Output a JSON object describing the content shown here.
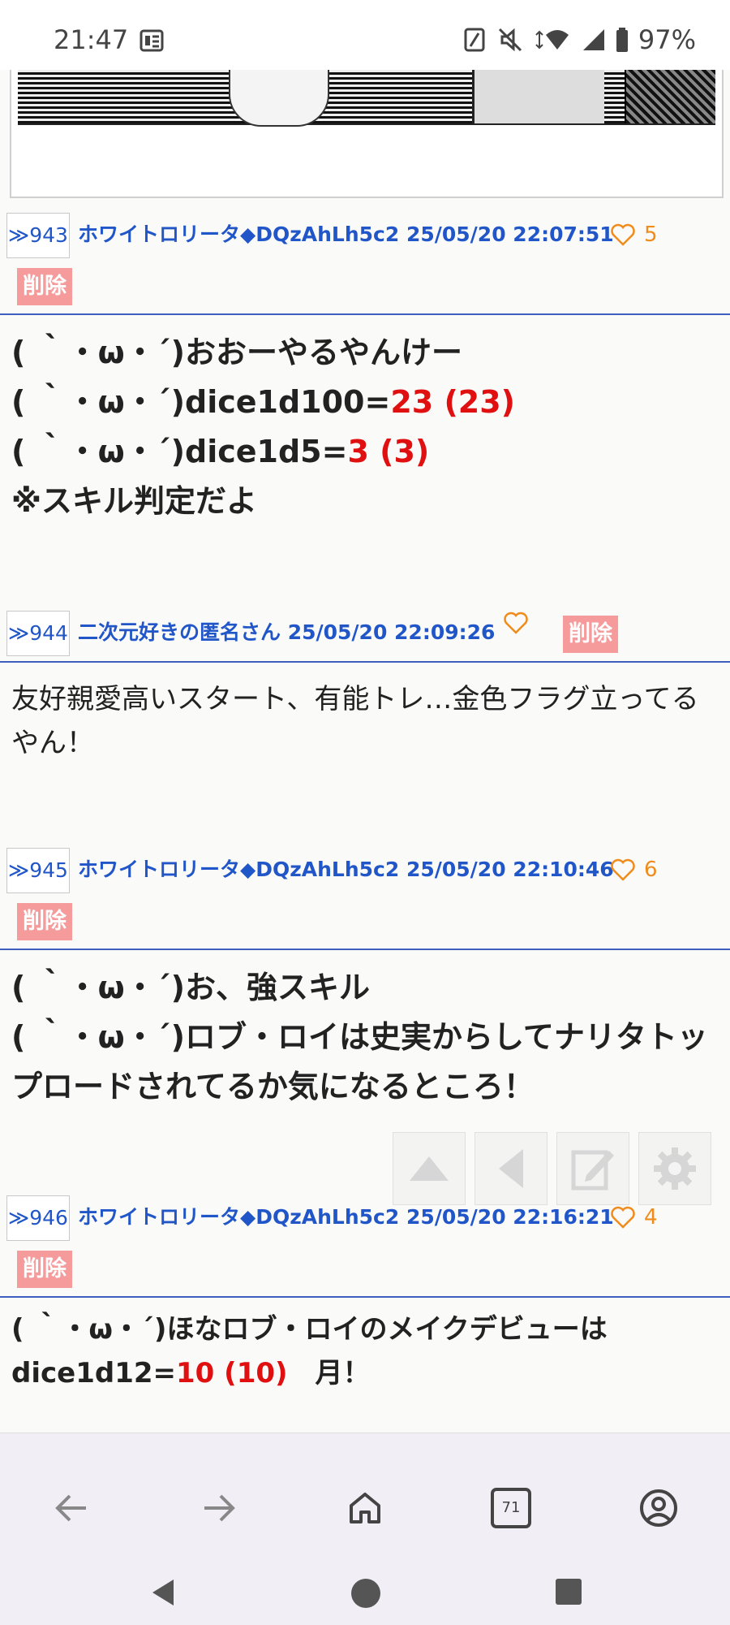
{
  "status_bar": {
    "time": "21:47",
    "battery": "97%"
  },
  "posts": [
    {
      "num": "≫943",
      "meta": "ホワイトロリータ◆DQzAhLh5c2 25/05/20 22:07:51",
      "likes": "5",
      "delete_label": "削除",
      "lines": [
        [
          "( ｀・ω・´)おおーやるやんけー"
        ],
        [
          "( ｀・ω・´)dice1d100=",
          "23 (23)"
        ],
        [
          "( ｀・ω・´)dice1d5=",
          "3 (3)"
        ],
        [
          "※スキル判定だよ"
        ]
      ]
    },
    {
      "num": "≫944",
      "meta": "二次元好きの匿名さん 25/05/20 22:09:26",
      "likes": "",
      "delete_label": "削除",
      "text": "友好親愛高いスタート、有能トレ…金色フラグ立ってるやん！"
    },
    {
      "num": "≫945",
      "meta": "ホワイトロリータ◆DQzAhLh5c2 25/05/20 22:10:46",
      "likes": "6",
      "delete_label": "削除",
      "lines": [
        "( ｀・ω・´)お、強スキル",
        "( ｀・ω・´)ロブ・ロイは史実からしてナリタトップロードされてるか気になるところ！"
      ]
    },
    {
      "num": "≫946",
      "meta": "ホワイトロリータ◆DQzAhLh5c2 25/05/20 22:16:21",
      "likes": "4",
      "delete_label": "削除",
      "line1": "( ｀・ω・´)ほなロブ・ロイのメイクデビューは",
      "line2_prefix": "dice1d12=",
      "line2_roll": "10 (10)",
      "line2_suffix": "　月！"
    }
  ],
  "browser_nav": {
    "tab_count": "71"
  }
}
